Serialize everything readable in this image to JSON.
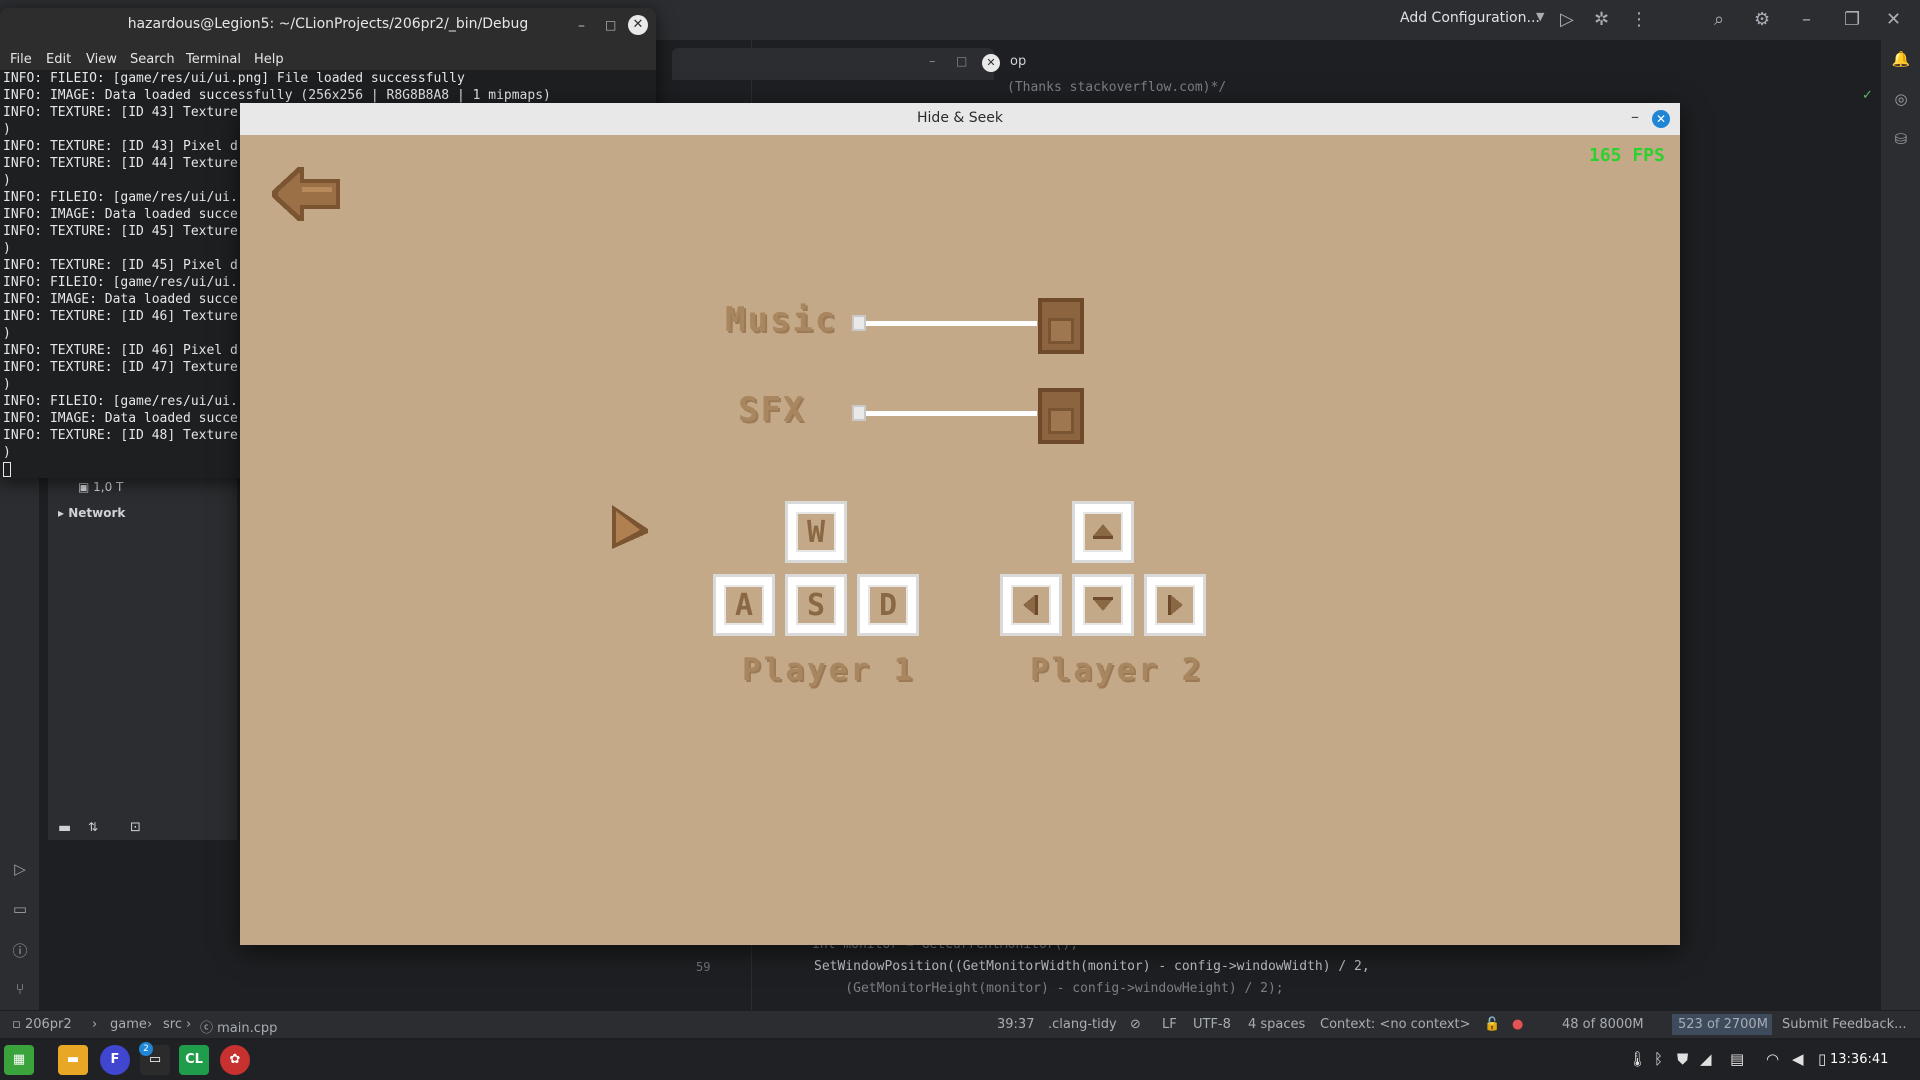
{
  "ide": {
    "add_configuration": "Add Configuration...",
    "comment_text": "(Thanks stackoverflow.com)*/",
    "tab_fragment": "op",
    "tree": {
      "item1": "1,0 T",
      "item2": "Network"
    },
    "code": {
      "line58": "int monitor = GetCurrentMonitor();",
      "line59_no": "59",
      "line59": "SetWindowPosition((GetMonitorWidth(monitor) - config->windowWidth) / 2,",
      "line60": "    (GetMonitorHeight(monitor) - config->windowHeight) / 2);"
    },
    "statusbar": {
      "project": "206pr2",
      "folder1": "game",
      "folder2": "src",
      "file": "main.cpp",
      "position": "39:37",
      "linter": ".clang-tidy",
      "line_ending": "LF",
      "encoding": "UTF-8",
      "indent": "4 spaces",
      "context": "Context: <no context>",
      "memory1": "48 of 8000M",
      "memory2": "523 of 2700M",
      "feedback": "Submit Feedback..."
    }
  },
  "terminal": {
    "title": "hazardous@Legion5: ~/CLionProjects/206pr2/_bin/Debug",
    "menu": [
      "File",
      "Edit",
      "View",
      "Search",
      "Terminal",
      "Help"
    ],
    "lines": [
      "INFO: FILEIO: [game/res/ui/ui.png] File loaded successfully",
      "INFO: IMAGE: Data loaded successfully (256x256 | R8G8B8A8 | 1 mipmaps)",
      "INFO: TEXTURE: [ID 43] Texture",
      ")",
      "INFO: TEXTURE: [ID 43] Pixel d",
      "INFO: TEXTURE: [ID 44] Texture",
      ")",
      "INFO: FILEIO: [game/res/ui/ui.",
      "INFO: IMAGE: Data loaded succe",
      "INFO: TEXTURE: [ID 45] Texture",
      ")",
      "INFO: TEXTURE: [ID 45] Pixel d",
      "INFO: FILEIO: [game/res/ui/ui.",
      "INFO: IMAGE: Data loaded succe",
      "INFO: TEXTURE: [ID 46] Texture",
      ")",
      "INFO: TEXTURE: [ID 46] Pixel d",
      "INFO: TEXTURE: [ID 47] Texture",
      ")",
      "INFO: FILEIO: [game/res/ui/ui.",
      "INFO: IMAGE: Data loaded succe",
      "INFO: TEXTURE: [ID 48] Texture",
      ")"
    ]
  },
  "game": {
    "window_title": "Hide & Seek",
    "fps": "165 FPS",
    "music_label": "Music",
    "sfx_label": "SFX",
    "music_volume": 1.0,
    "sfx_volume": 1.0,
    "player1": {
      "label": "Player 1",
      "keys": {
        "up": "W",
        "left": "A",
        "down": "S",
        "right": "D"
      }
    },
    "player2": {
      "label": "Player 2",
      "keys": {
        "up": "arrow-up-icon",
        "left": "arrow-left-icon",
        "down": "arrow-down-icon",
        "right": "arrow-right-icon"
      }
    },
    "colors": {
      "background": "#c4a988",
      "text": "#a88660",
      "fps": "#2dd12d",
      "arrow": "#9c7047"
    }
  },
  "taskbar": {
    "badge": "2",
    "clion_label": "CL",
    "clock": "13:36:41"
  }
}
